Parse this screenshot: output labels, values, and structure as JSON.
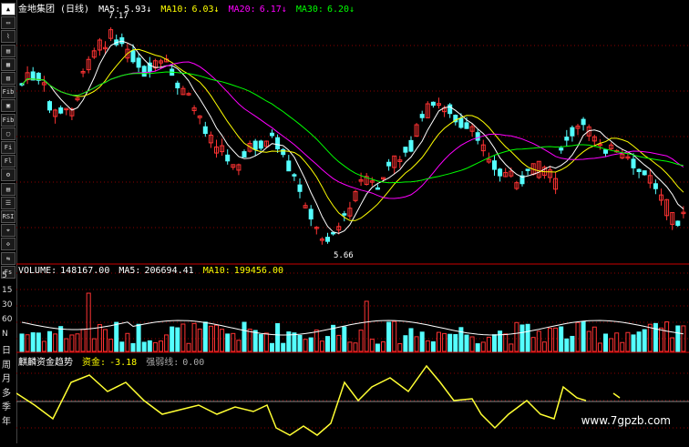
{
  "toolbar": {
    "buttons": [
      "▲",
      "▭",
      "⌇",
      "▤",
      "▦",
      "▥",
      "Fib",
      "▣",
      "Fib",
      "▢",
      "Fi",
      "Fl",
      "⚙",
      "▤",
      "☰",
      "RSI",
      "⌖",
      "✣",
      "⇆",
      "Fs"
    ],
    "period_labels": [
      "日",
      "周",
      "月",
      "多",
      "季",
      "年"
    ],
    "volume_scale": [
      "5",
      "15",
      "30",
      "60",
      "N"
    ]
  },
  "main_header": {
    "stock": "金地集团 (日线)",
    "ma5_label": "MA5:",
    "ma5_value": "5.93↓",
    "ma10_label": "MA10:",
    "ma10_value": "6.03↓",
    "ma20_label": "MA20:",
    "ma20_value": "6.17↓",
    "ma30_label": "MA30:",
    "ma30_value": "6.20↓"
  },
  "high_marker": "7.17",
  "low_marker": "5.66",
  "volume_header": {
    "volume_label": "VOLUME:",
    "volume_value": "148167.00",
    "ma5_label": "MA5:",
    "ma5_value": "206694.41",
    "ma10_label": "MA10:",
    "ma10_value": "199456.00"
  },
  "fund_header": {
    "title": "麒麟资金趋势",
    "fund_label": "资金:",
    "fund_value": "-3.18",
    "strength_label": "强弱线:",
    "strength_value": "0.00"
  },
  "watermark": "www.7gpzb.com",
  "colors": {
    "up": "#ff3333",
    "down": "#54ffff",
    "ma5": "#ffffff",
    "ma10": "#ffff00",
    "ma20": "#ff00ff",
    "ma30": "#00ff00",
    "fund": "#ffff33",
    "grid": "#8b0000"
  }
}
